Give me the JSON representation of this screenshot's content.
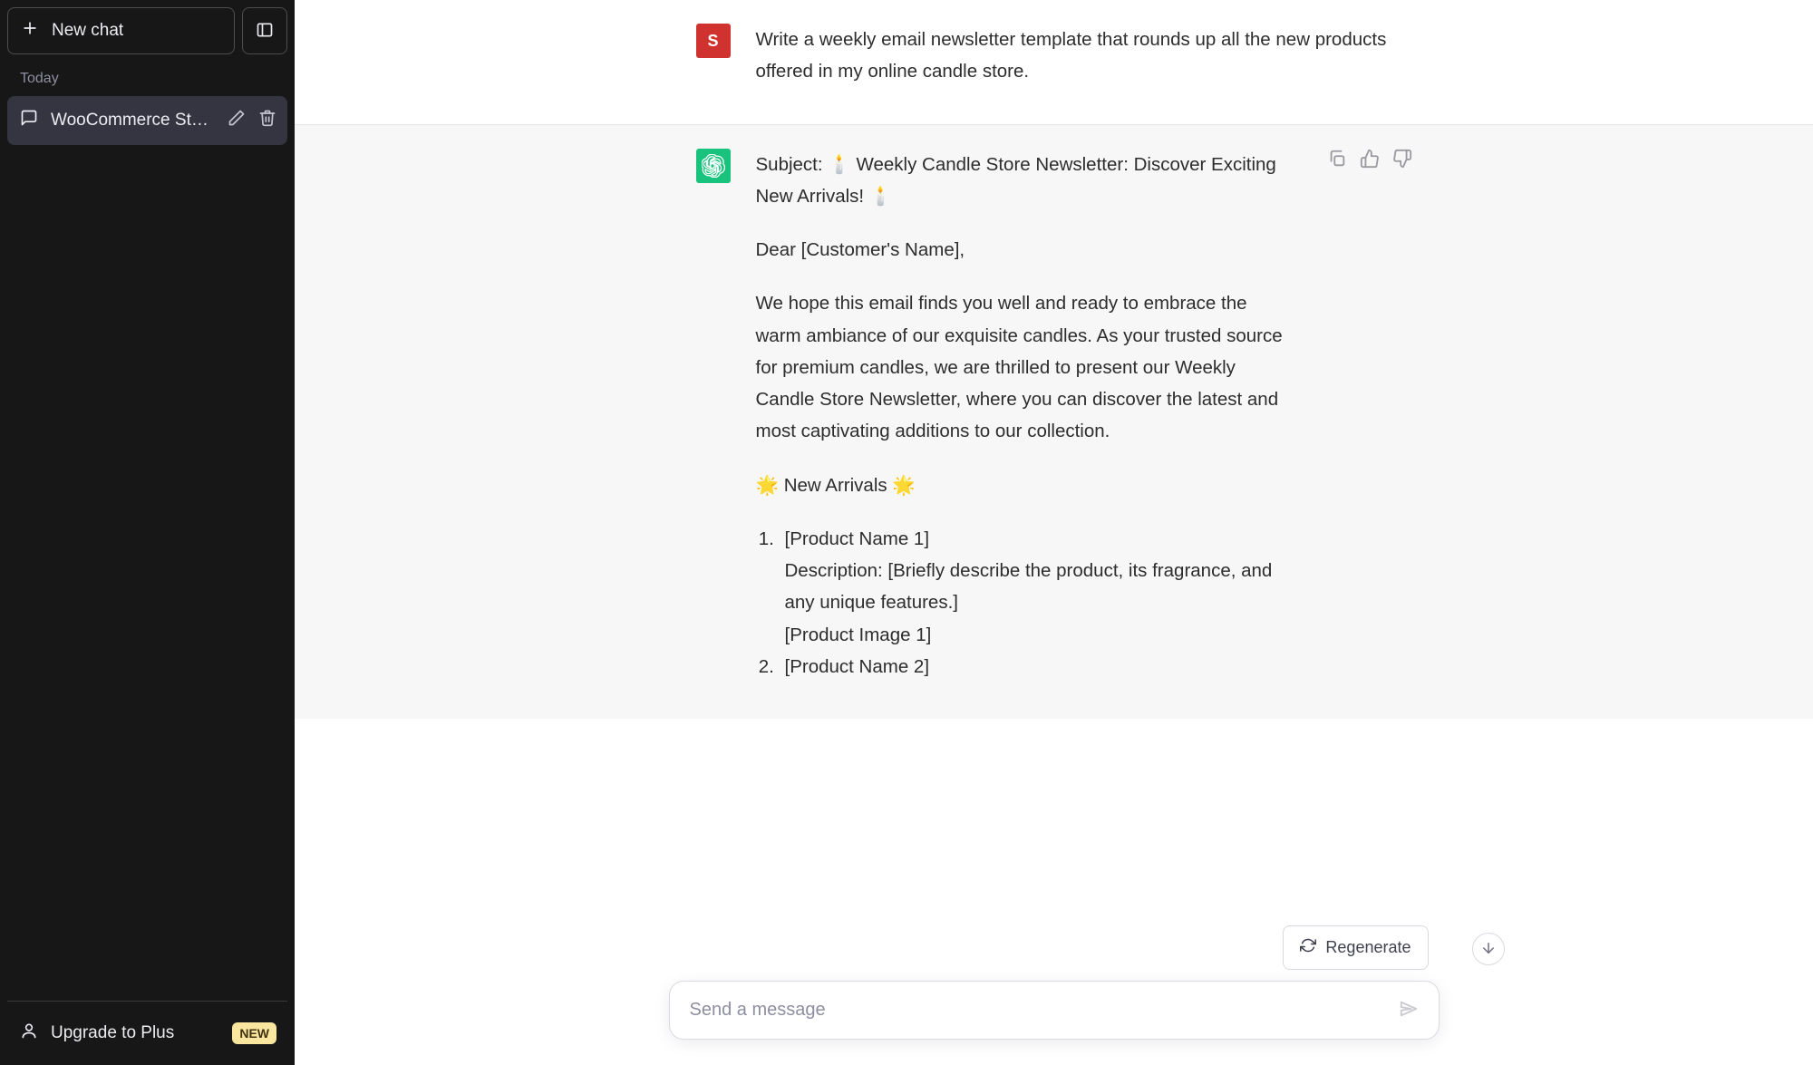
{
  "sidebar": {
    "new_chat_label": "New chat",
    "section_label": "Today",
    "chats": [
      {
        "title": "WooCommerce Store"
      }
    ],
    "upgrade_label": "Upgrade to Plus",
    "badge_label": "NEW"
  },
  "conversation": {
    "user": {
      "avatar_initial": "S",
      "text": "Write a weekly email newsletter template that rounds up all the new products offered in my online candle store."
    },
    "assistant": {
      "subject": "Subject: 🕯️ Weekly Candle Store Newsletter: Discover Exciting New Arrivals! 🕯️",
      "greeting": "Dear [Customer's Name],",
      "intro": "We hope this email finds you well and ready to embrace the warm ambiance of our exquisite candles. As your trusted source for premium candles, we are thrilled to present our Weekly Candle Store Newsletter, where you can discover the latest and most captivating additions to our collection.",
      "section_heading": "🌟 New Arrivals 🌟",
      "items": [
        {
          "name": "[Product Name 1]",
          "desc": "Description: [Briefly describe the product, its fragrance, and any unique features.]",
          "image": "[Product Image 1]"
        },
        {
          "name": "[Product Name 2]"
        }
      ]
    }
  },
  "actions": {
    "regenerate_label": "Regenerate"
  },
  "composer": {
    "placeholder": "Send a message"
  }
}
